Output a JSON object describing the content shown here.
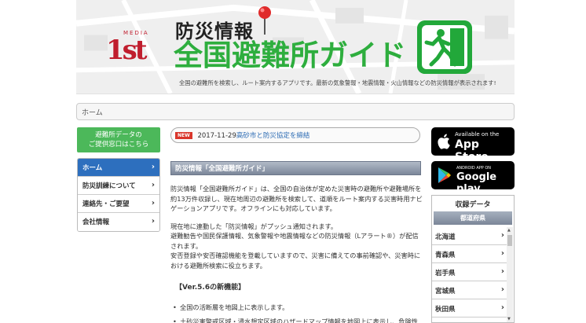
{
  "header": {
    "logo_media": "MEDIA",
    "logo_text": "1st",
    "title_sub": "防災情報",
    "title_main": "全国避難所ガイド",
    "description": "全国の避難所を検索し、ルート案内するアプリです。最新の気象警報・地震情報・火山情報などの防災情報が表示されます!"
  },
  "breadcrumb": {
    "home": "ホーム"
  },
  "left": {
    "provide_button": [
      "避難所データの",
      "ご提供窓口はこちら"
    ],
    "nav": [
      {
        "label": "ホーム",
        "active": true
      },
      {
        "label": "防災訓練について",
        "active": false
      },
      {
        "label": "連絡先・ご要望",
        "active": false
      },
      {
        "label": "会社情報",
        "active": false
      }
    ]
  },
  "news": {
    "badge": "NEW",
    "date": "2017-11-29",
    "link_text": "高砂市と防災協定を締結"
  },
  "section_title": "防災情報「全国避難所ガイド」",
  "content": {
    "para1": "防災情報「全国避難所ガイド」は、全国の自治体が定めた災害時の避難所や避難場所を約13万件収録し、現在地周辺の避難所を検索して、道順をルート案内する災害時用ナビゲーションアプリです。オフラインにも対応しています。",
    "para2_lines": [
      "現在地に連動した「防災情報」がプッシュ通知されます。",
      "避難勧告や国民保護情報、気象警報や地震情報などの防災情報（Lアラート®）が配信されます。",
      "安否登録や安否確認機能を登載していますので、災害に備えての事前確認や、災害時における避難所検索に役立ちます。"
    ],
    "version_heading": "【Ver.5.6の新機能】",
    "features": [
      "全国の活断層を地図上に表示します。",
      "土砂災害警戒区域・浸水想定区域のハザードマップ情報を地図上に表示し、危険性"
    ]
  },
  "right": {
    "app_store": {
      "small": "Available on the",
      "big": "App Store"
    },
    "google_play": {
      "small": "ANDROID APP ON",
      "big": "Google play"
    },
    "pref_title": "収録データ",
    "pref_sub": "都道府県",
    "prefectures": [
      "北海道",
      "青森県",
      "岩手県",
      "宮城県",
      "秋田県"
    ]
  },
  "colors": {
    "brand_red": "#c01e2e",
    "brand_green": "#2eae3e",
    "nav_active": "#2d6fbe",
    "button_green": "#4cb85a"
  },
  "icons": [
    "map-pin-icon",
    "emergency-exit-icon",
    "apple-icon",
    "google-play-icon",
    "chevron-right-icon"
  ]
}
